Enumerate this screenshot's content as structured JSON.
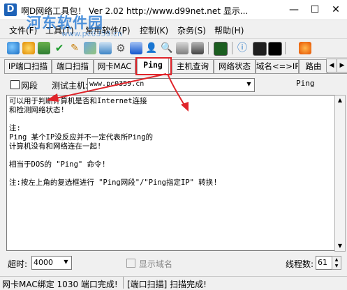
{
  "window": {
    "title": "啊D网络工具包！ Ver 2.02   http://www.d99net.net   显示...",
    "app_icon_letter": "D",
    "watermark": "河东软件园",
    "watermark_url": "www.pc0359.cn"
  },
  "menu": {
    "items": [
      "文件(F)",
      "工具(T)",
      "常用软件(P)",
      "控制(K)",
      "杂务(S)",
      "帮助(H)"
    ]
  },
  "toolbar": {
    "icons": [
      "globe-search-icon",
      "refresh-icon",
      "filter-icon",
      "check-icon",
      "pen-icon",
      "image-icon",
      "chart-icon",
      "gear-icon",
      "network-icon",
      "user-icon",
      "search-icon",
      "computer-icon",
      "monitor-icon",
      "terminal-icon",
      "info-icon",
      "screen-icon",
      "cmd-icon",
      "fox-icon"
    ]
  },
  "tabs": [
    "IP端口扫描",
    "端口扫描",
    "网卡MAC",
    "Ping",
    "主机查询",
    "网络状态",
    "域名<=>IP",
    "路由"
  ],
  "active_tab": "Ping",
  "host_row": {
    "segment_label": "网段",
    "host_label": "测试主机:",
    "host_value": "www.pc0359.cn",
    "ping_button": "Ping"
  },
  "output": {
    "text": "可以用于判断计算机是否和Internet连接\n和检测网络状态!\n\n注:\nPing 某个IP没反应并不一定代表所Ping的\n计算机没有和网络连在一起!\n\n相当于DOS的 \"Ping\" 命令!\n\n注:按左上角的复选框进行 \"Ping网段\"/\"Ping指定IP\" 转换!"
  },
  "bottom": {
    "timeout_label": "超时:",
    "timeout_value": "4000",
    "show_domain_label": "显示域名",
    "threads_label": "线程数:",
    "threads_value": "61"
  },
  "status": {
    "left": "网卡MAC绑定 1030 端口完成!",
    "right": "[端口扫描] 扫描完成!"
  },
  "colors": {
    "annotation_red": "#e0242a",
    "watermark_blue": "#2f7fd6"
  }
}
